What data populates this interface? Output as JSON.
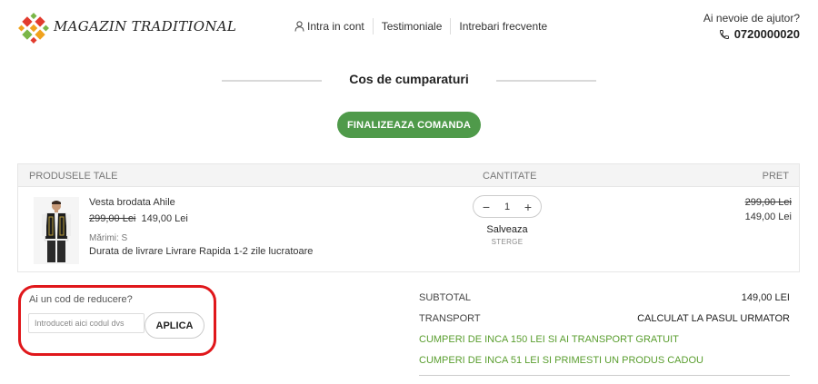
{
  "header": {
    "brand": "MAGAZIN TRADITIONAL",
    "nav": [
      {
        "label": "Intra in cont"
      },
      {
        "label": "Testimoniale"
      },
      {
        "label": "Intrebari frecvente"
      }
    ],
    "help_question": "Ai nevoie de ajutor?",
    "phone": "0720000020"
  },
  "cart": {
    "title": "Cos de cumparaturi",
    "finalize_label": "FINALIZEAZA COMANDA",
    "columns": {
      "products": "PRODUSELE TALE",
      "quantity": "CANTITATE",
      "price": "PRET"
    },
    "item": {
      "name": "Vesta brodata Ahile",
      "old_price": "299,00 Lei",
      "new_price": "149,00 Lei",
      "sizes": "Mărimi: S",
      "delivery": "Durata de livrare Livrare Rapida 1-2 zile lucratoare",
      "quantity": "1",
      "save_label": "Salveaza",
      "delete_label": "STERGE",
      "line_old_price": "299,00 Lei",
      "line_new_price": "149,00 Lei"
    }
  },
  "discount": {
    "question": "Ai un cod de reducere?",
    "placeholder": "Introduceti aici codul dvs",
    "apply_label": "APLICA"
  },
  "summary": {
    "subtotal_label": "SUBTOTAL",
    "subtotal_value": "149,00 LEI",
    "transport_label": "TRANSPORT",
    "transport_value": "CALCULAT LA PASUL URMATOR",
    "promo_free_shipping": "CUMPERI DE INCA 150 LEI SI AI TRANSPORT GRATUIT",
    "promo_gift": "CUMPERI DE INCA 51 LEI SI PRIMESTI UN PRODUS CADOU"
  },
  "colors": {
    "accent_green": "#4f9a4a",
    "promo_green": "#5a9e2f",
    "highlight_red": "#e0171b"
  }
}
